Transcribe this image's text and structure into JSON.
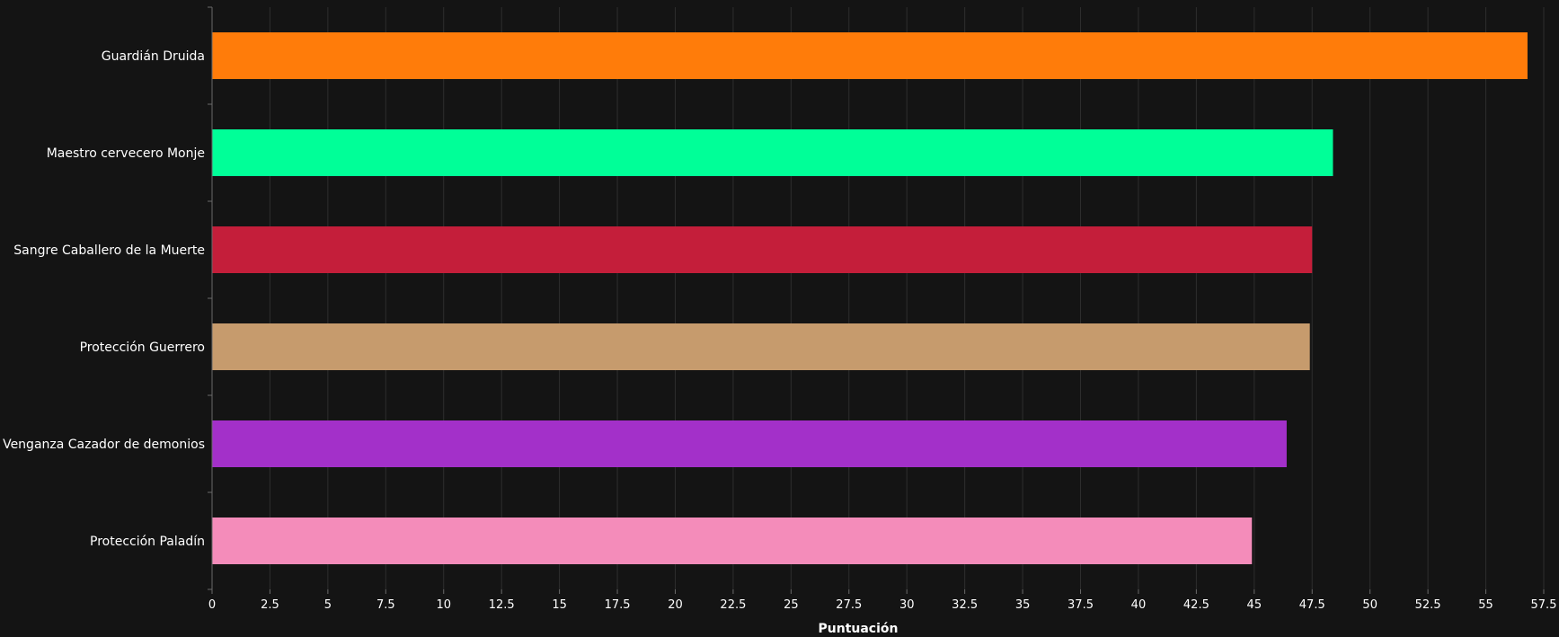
{
  "chart_data": {
    "type": "bar",
    "orientation": "horizontal",
    "categories": [
      "Guardián Druida",
      "Maestro cervecero Monje",
      "Sangre Caballero de la Muerte",
      "Protección Guerrero",
      "Venganza Cazador de demonios",
      "Protección Paladín"
    ],
    "values": [
      56.8,
      48.4,
      47.5,
      47.4,
      46.4,
      44.9
    ],
    "colors": [
      "#ff7c0a",
      "#00ff98",
      "#c41e3a",
      "#c69b6d",
      "#a330c9",
      "#f48cba"
    ],
    "xlabel": "Puntuación",
    "xlim": [
      0,
      57.5
    ],
    "xticks": [
      0,
      2.5,
      5,
      7.5,
      10,
      12.5,
      15,
      17.5,
      20,
      22.5,
      25,
      27.5,
      30,
      32.5,
      35,
      37.5,
      40,
      42.5,
      45,
      47.5,
      50,
      52.5,
      55,
      57.5
    ],
    "xtick_labels": [
      "0",
      "2.5",
      "5",
      "7.5",
      "10",
      "12.5",
      "15",
      "17.5",
      "20",
      "22.5",
      "25",
      "27.5",
      "30",
      "32.5",
      "35",
      "37.5",
      "40",
      "42.5",
      "45",
      "47.5",
      "50",
      "52.5",
      "55",
      "57.5"
    ],
    "grid": true,
    "background": "#141414",
    "text_color": "#ffffff",
    "grid_color": "#2e2e2e"
  }
}
